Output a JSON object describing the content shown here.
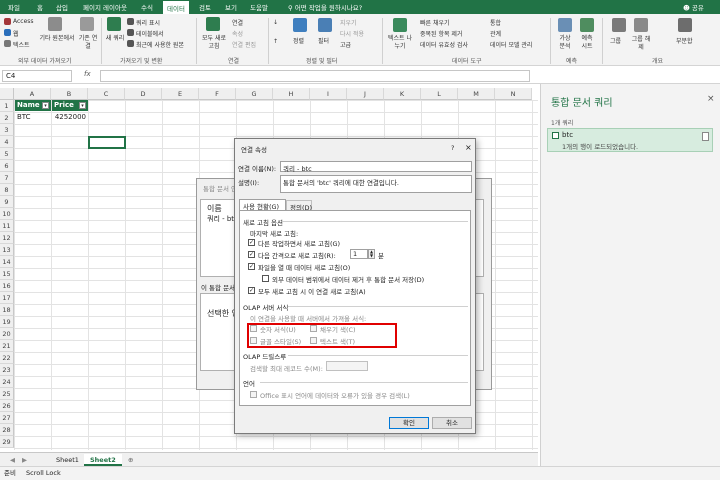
{
  "ribbon": {
    "tabs": [
      "파일",
      "홈",
      "삽입",
      "페이지 레이아웃",
      "수식",
      "데이터",
      "검토",
      "보기",
      "도움말"
    ],
    "active_tab": "데이터",
    "tell_me": "어떤 작업을 원하시나요?",
    "share": "공유",
    "items": {
      "access": "Access",
      "web": "웹",
      "text": "텍스트",
      "other_sources": "기타 원본에서",
      "existing_conn": "기존 연결",
      "new_query": "새 쿼리",
      "show_queries": "쿼리 표시",
      "from_table": "테이블에서",
      "recent_sources": "최근에 사용한 원본",
      "refresh_all": "모두 새로 고침",
      "connections": "연결",
      "properties": "속성",
      "edit_links": "연결 편집",
      "sort": "정렬",
      "filter": "필터",
      "clear": "지우기",
      "reapply": "다시 적용",
      "advanced": "고급",
      "text_to_columns": "텍스트 나누기",
      "flash_fill": "빠른 채우기",
      "remove_duplicates": "중복된 항목 제거",
      "data_validation": "데이터 유효성 검사",
      "consolidate": "통합",
      "relationships": "관계",
      "data_model": "데이터 모델 관리",
      "what_if": "가상 분석",
      "forecast_sheet": "예측 시트",
      "group": "그룹",
      "ungroup": "그룹 해제",
      "subtotal": "부분합"
    },
    "groups": {
      "external": "외부 데이터 가져오기",
      "get_transform": "가져오기 및 변환",
      "connections": "연결",
      "sort_filter": "정렬 및 필터",
      "data_tools": "데이터 도구",
      "forecast": "예측",
      "outline": "개요"
    }
  },
  "formula_bar": {
    "name_box": "C4",
    "fx": "fx",
    "value": ""
  },
  "grid": {
    "columns": [
      "A",
      "B",
      "C",
      "D",
      "E",
      "F",
      "G",
      "H",
      "I",
      "J",
      "K",
      "L",
      "M",
      "N"
    ],
    "rows": [
      "1",
      "2",
      "3",
      "4",
      "5",
      "6",
      "7",
      "8",
      "9",
      "10",
      "11",
      "12",
      "13",
      "14",
      "15",
      "16",
      "17",
      "18",
      "19",
      "20",
      "21",
      "22",
      "23",
      "24",
      "25",
      "26",
      "27",
      "28",
      "29"
    ],
    "header": [
      "Name",
      "Price"
    ],
    "data": [
      "BTC",
      "4252000"
    ]
  },
  "sheets": [
    "Sheet1",
    "Sheet2"
  ],
  "active_sheet": "Sheet2",
  "status": {
    "ready": "준비",
    "scroll": "Scroll Lock"
  },
  "pane": {
    "title": "통합 문서 쿼리",
    "close": "×",
    "count": "1개 쿼리",
    "query_name": "btc",
    "query_status": "1개의 행이 로드되었습니다."
  },
  "bg_dialog": {
    "title": "통합 문서 연",
    "name_label": "이름",
    "name_value": "쿼리 - bt",
    "section": "이 통합 문서",
    "info": "선택한 연"
  },
  "dialog": {
    "title": "연결 속성",
    "help": "?",
    "close": "×",
    "conn_name_label": "연결 이름(N):",
    "conn_name_value": "쿼리 - btc",
    "desc_label": "설명(I):",
    "desc_value": "통합 문서의 'btc' 쿼리에 대한 연결입니다.",
    "tabs": [
      "사용 현황(G)",
      "정의(D)"
    ],
    "refresh_section": "새로 고침 옵션",
    "last_refresh": "마지막 새로 고침:",
    "bg_refresh": "다른 작업하면서 새로 고침(G)",
    "interval_refresh": "다음 간격으로 새로 고침(R):",
    "interval_value": "1",
    "interval_unit": "분",
    "refresh_on_open": "파일을 열 때 데이터 새로 고침(O)",
    "remove_external": "외부 데이터 범위에서 데이터 제거 후 통합 문서 저장(D)",
    "refresh_all_conn": "모두 새로 고침 시 이 연결 새로 고침(A)",
    "olap_format": "OLAP 서버 서식",
    "olap_desc": "이 연결을 사용할 때 서버에서 가져올 서식:",
    "number_format": "숫자 서식(U)",
    "fill_color": "채우기 색(C)",
    "font_style": "글꼴 스타일(S)",
    "text_color": "텍스트 색(T)",
    "olap_drill": "OLAP 드릴스루",
    "max_records": "검색할 최대 레코드 수(M):",
    "language": "언어",
    "language_desc": "Office 표시 언어에 데이터와 오류가 있을 경우 검색(L)",
    "ok": "확인",
    "cancel": "취소"
  }
}
